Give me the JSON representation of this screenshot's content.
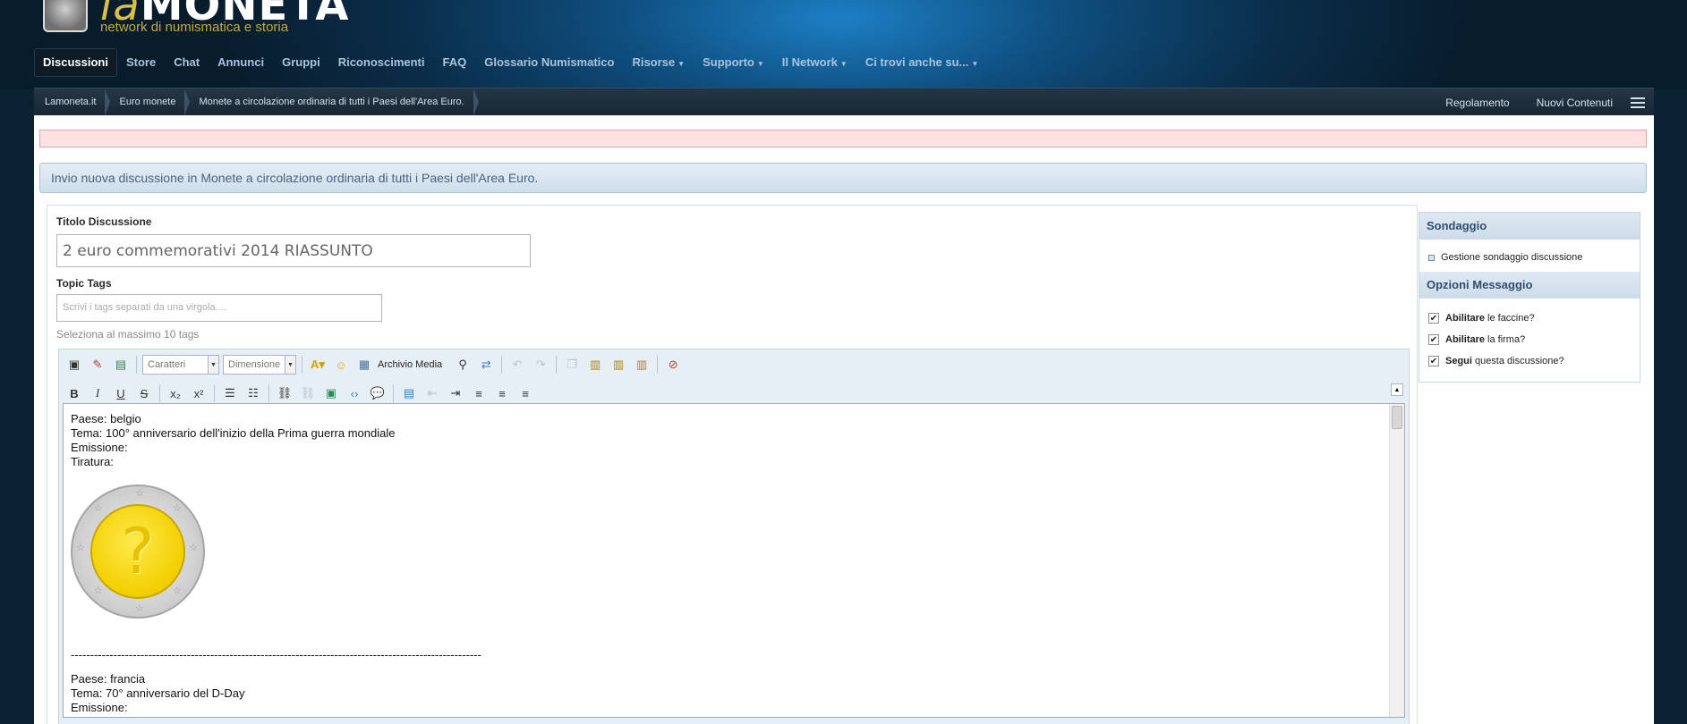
{
  "logo": {
    "brand_prefix": "la",
    "brand_main": "MONETA",
    "subtitle": "network di numismatica e storia"
  },
  "nav": {
    "items": [
      {
        "label": "Discussioni",
        "active": true
      },
      {
        "label": "Store"
      },
      {
        "label": "Chat"
      },
      {
        "label": "Annunci"
      },
      {
        "label": "Gruppi"
      },
      {
        "label": "Riconoscimenti"
      },
      {
        "label": "FAQ"
      },
      {
        "label": "Glossario Numismatico"
      },
      {
        "label": "Risorse",
        "dropdown": true
      },
      {
        "label": "Supporto",
        "dropdown": true
      },
      {
        "label": "Il Network",
        "dropdown": true
      },
      {
        "label": "Ci trovi anche su...",
        "dropdown": true
      }
    ]
  },
  "breadcrumb": {
    "items": [
      "Lamoneta.it",
      "Euro monete",
      "Monete a circolazione ordinaria di tutti i Paesi dell'Area Euro."
    ],
    "right_links": [
      "Regolamento",
      "Nuovi Contenuti"
    ]
  },
  "page": {
    "title": "Invio nuova discussione in Monete a circolazione ordinaria di tutti i Paesi dell'Area Euro."
  },
  "form": {
    "title_label": "Titolo Discussione",
    "title_value": "2 euro commemorativi 2014 RIASSUNTO",
    "tags_label": "Topic Tags",
    "tags_placeholder": "Scrivi i tags separati da una virgola....",
    "tags_hint": "Seleziona al massimo 10 tags"
  },
  "editor": {
    "font_select": "Caratteri",
    "size_select": "Dimensione",
    "media_button": "Archivio Media",
    "content": {
      "block1": [
        "Paese: belgio",
        "Tema: 100° anniversario dell'inizio della Prima guerra mondiale",
        "Emissione:",
        "Tiratura:"
      ],
      "divider": "----------------------------------------------------------------------------------------------------------",
      "block2": [
        "Paese: francia",
        "Tema: 70° anniversario del D-Day",
        "Emissione:"
      ]
    }
  },
  "sidebar": {
    "poll_heading": "Sondaggio",
    "poll_item": "Gestione sondaggio discussione",
    "options_heading": "Opzioni Messaggio",
    "options": [
      {
        "bold": "Abilitare",
        "rest": "le faccine?",
        "checked": true
      },
      {
        "bold": "Abilitare",
        "rest": "la firma?",
        "checked": true
      },
      {
        "bold": "Segui",
        "rest": "questa discussione?",
        "checked": true
      }
    ]
  },
  "colors": {
    "accent": "#0e1a24",
    "title_bar": "#cfdeec",
    "coin_gold": "#f2cf00"
  }
}
